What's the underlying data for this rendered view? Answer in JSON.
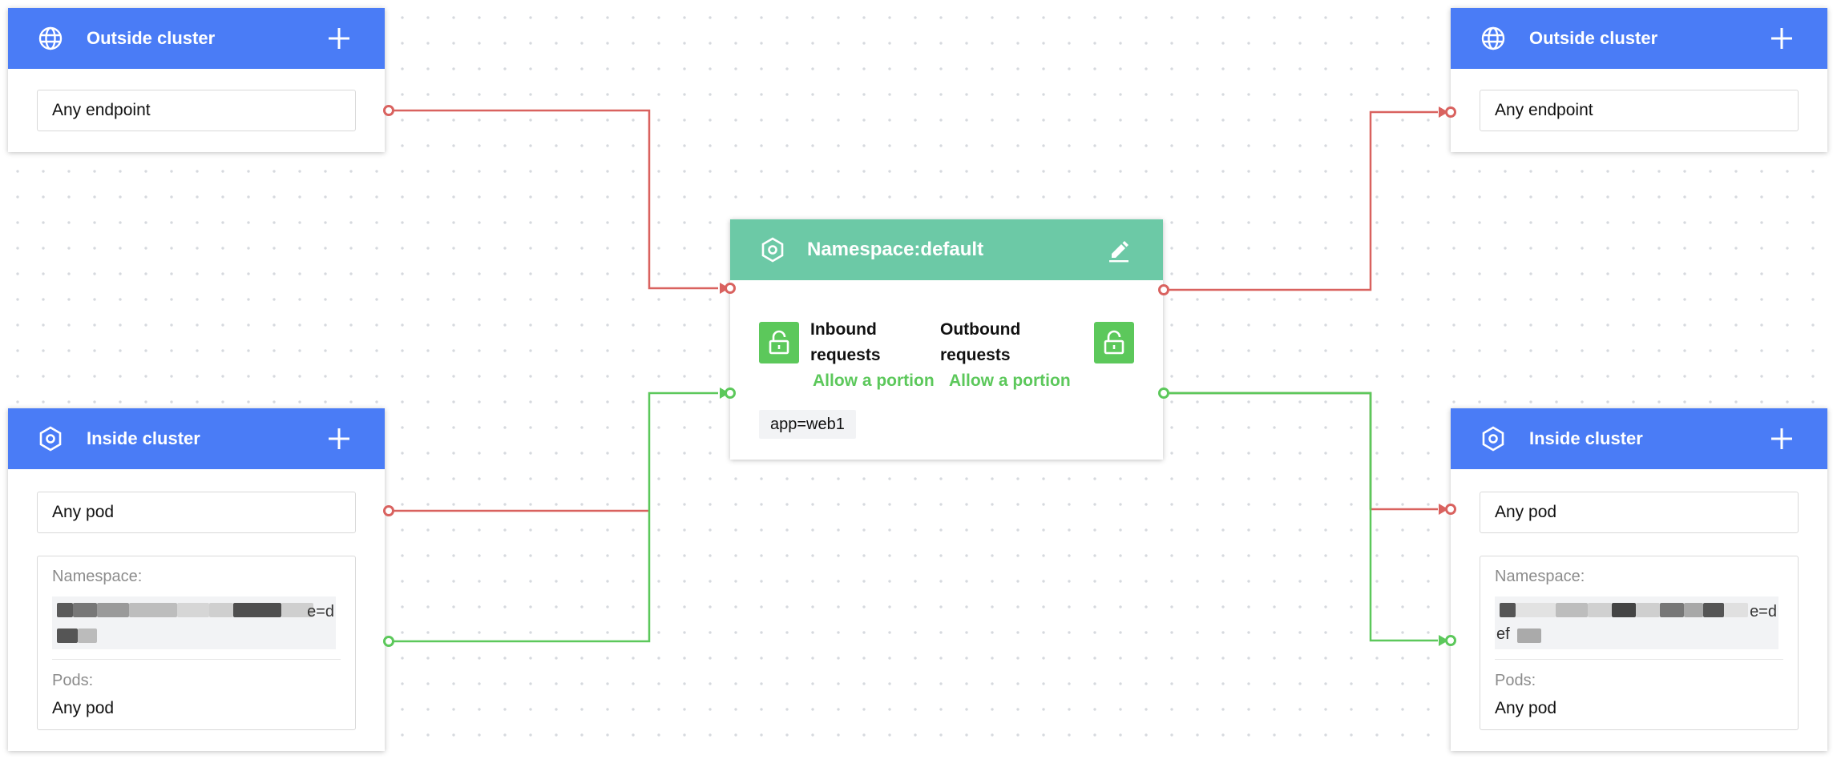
{
  "colors": {
    "header_blue": "#4a7cf6",
    "header_green": "#6cc9a6",
    "deny_red": "#d9625f",
    "allow_green": "#5cc85b"
  },
  "namespace_node": {
    "title": "Namespace:default",
    "icon": "kubernetes-icon",
    "inbound": {
      "title": "Inbound requests",
      "status": "Allow a portion",
      "icon": "unlock-icon"
    },
    "outbound": {
      "title": "Outbound requests",
      "status": "Allow a portion",
      "icon": "unlock-icon"
    },
    "label": "app=web1"
  },
  "left_outside": {
    "title": "Outside cluster",
    "icon": "globe-icon",
    "field": "Any endpoint"
  },
  "left_inside": {
    "title": "Inside cluster",
    "icon": "kubernetes-icon",
    "field": "Any pod",
    "namespace_label": "Namespace:",
    "namespace_suffix": "e=d",
    "namespace_suffix2": "efa",
    "pods_label": "Pods:",
    "pods_value": "Any pod"
  },
  "right_outside": {
    "title": "Outside cluster",
    "icon": "globe-icon",
    "field": "Any endpoint"
  },
  "right_inside": {
    "title": "Inside cluster",
    "icon": "kubernetes-icon",
    "field": "Any pod",
    "namespace_label": "Namespace:",
    "namespace_suffix": "e=d",
    "namespace_suffix2": "ef",
    "pods_label": "Pods:",
    "pods_value": "Any pod"
  }
}
